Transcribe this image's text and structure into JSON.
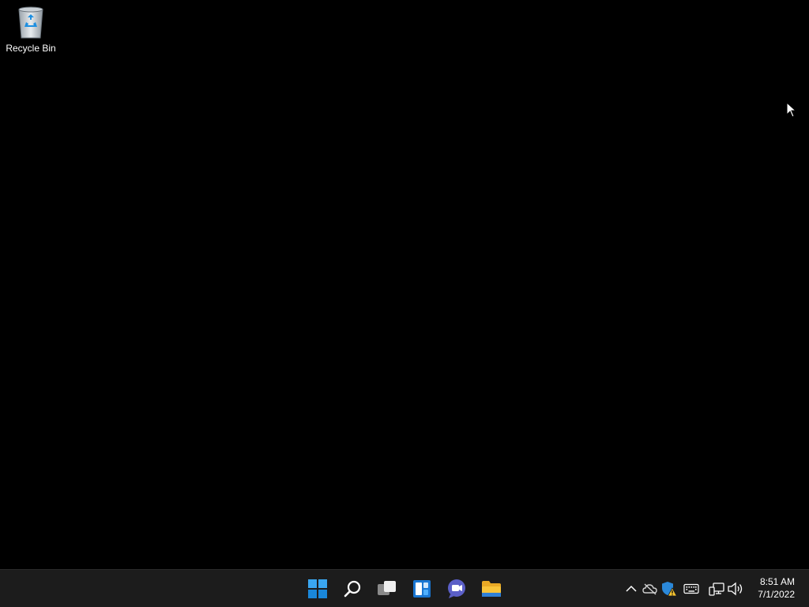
{
  "desktop": {
    "icons": [
      {
        "label": "Recycle Bin",
        "icon": "recycle-bin-icon"
      }
    ]
  },
  "taskbar": {
    "pinned": [
      {
        "name": "Start",
        "icon": "windows-start-icon"
      },
      {
        "name": "Search",
        "icon": "search-icon"
      },
      {
        "name": "Task View",
        "icon": "task-view-icon"
      },
      {
        "name": "Widgets",
        "icon": "widgets-icon"
      },
      {
        "name": "Chat",
        "icon": "teams-chat-icon"
      },
      {
        "name": "File Explorer",
        "icon": "file-explorer-icon"
      }
    ],
    "tray": [
      {
        "icon": "chevron-up-icon"
      },
      {
        "icon": "onedrive-offline-icon"
      },
      {
        "icon": "windows-security-warning-icon"
      },
      {
        "icon": "keyboard-icon"
      },
      {
        "icon": "network-icon"
      },
      {
        "icon": "volume-icon"
      }
    ],
    "clock": {
      "time": "8:51 AM",
      "date": "7/1/2022"
    }
  },
  "colors": {
    "desktop_bg": "#000000",
    "taskbar_bg": "#1c1c1c",
    "accent": "#0078d4",
    "folder": "#f8c43a"
  }
}
